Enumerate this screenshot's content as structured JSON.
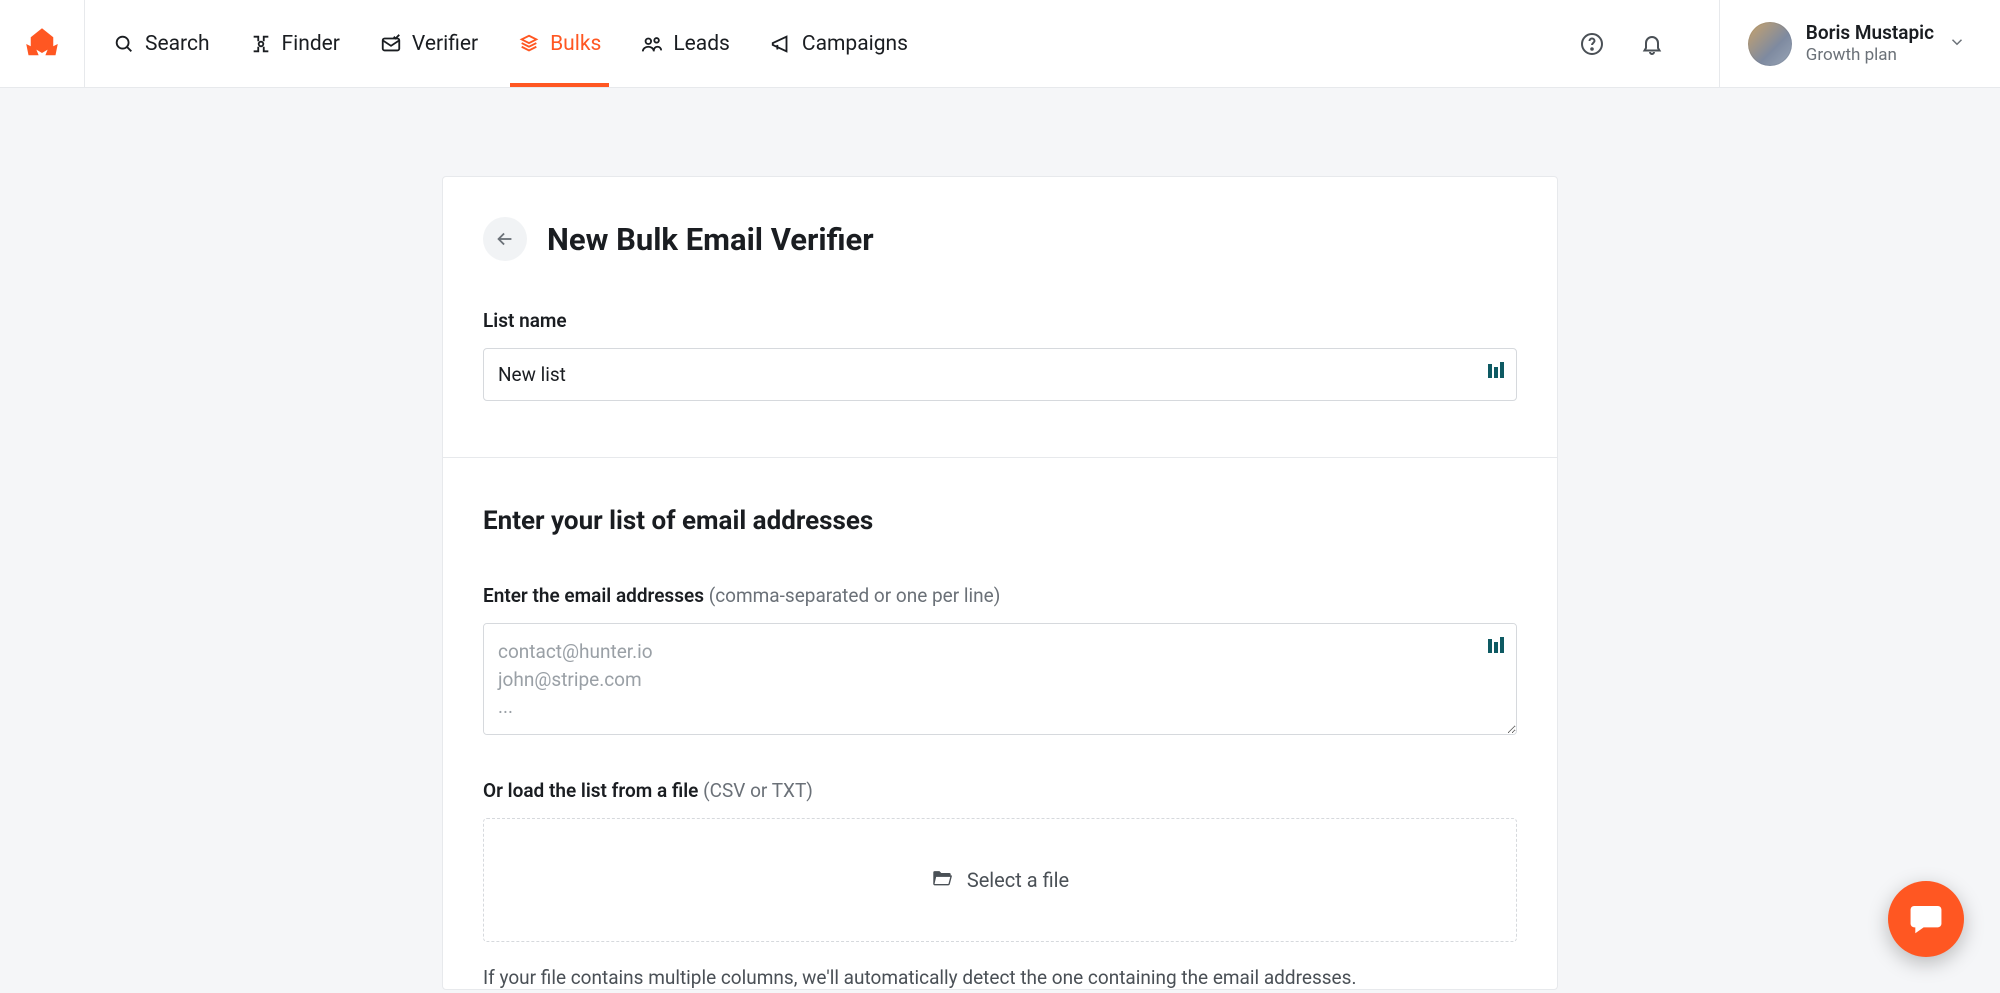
{
  "colors": {
    "accent": "#ff5722",
    "text": "#1a1d21",
    "muted": "#6b7178",
    "border": "#e7e9ec"
  },
  "nav": {
    "items": [
      {
        "id": "search",
        "label": "Search",
        "icon": "search-icon"
      },
      {
        "id": "finder",
        "label": "Finder",
        "icon": "finder-icon"
      },
      {
        "id": "verifier",
        "label": "Verifier",
        "icon": "verifier-icon"
      },
      {
        "id": "bulks",
        "label": "Bulks",
        "icon": "bulks-icon",
        "active": true
      },
      {
        "id": "leads",
        "label": "Leads",
        "icon": "leads-icon"
      },
      {
        "id": "campaigns",
        "label": "Campaigns",
        "icon": "campaigns-icon"
      }
    ]
  },
  "user": {
    "name": "Boris Mustapic",
    "plan": "Growth plan"
  },
  "page": {
    "title": "New Bulk Email Verifier",
    "list_name_label": "List name",
    "list_name_value": "New list",
    "section_heading": "Enter your list of email addresses",
    "email_label": "Enter the email addresses",
    "email_hint": "(comma-separated or one per line)",
    "email_placeholder": "contact@hunter.io\njohn@stripe.com\n...",
    "file_label": "Or load the list from a file",
    "file_hint": "(CSV or TXT)",
    "file_button": "Select a file",
    "file_note": "If your file contains multiple columns, we'll automatically detect the one containing the email addresses."
  }
}
